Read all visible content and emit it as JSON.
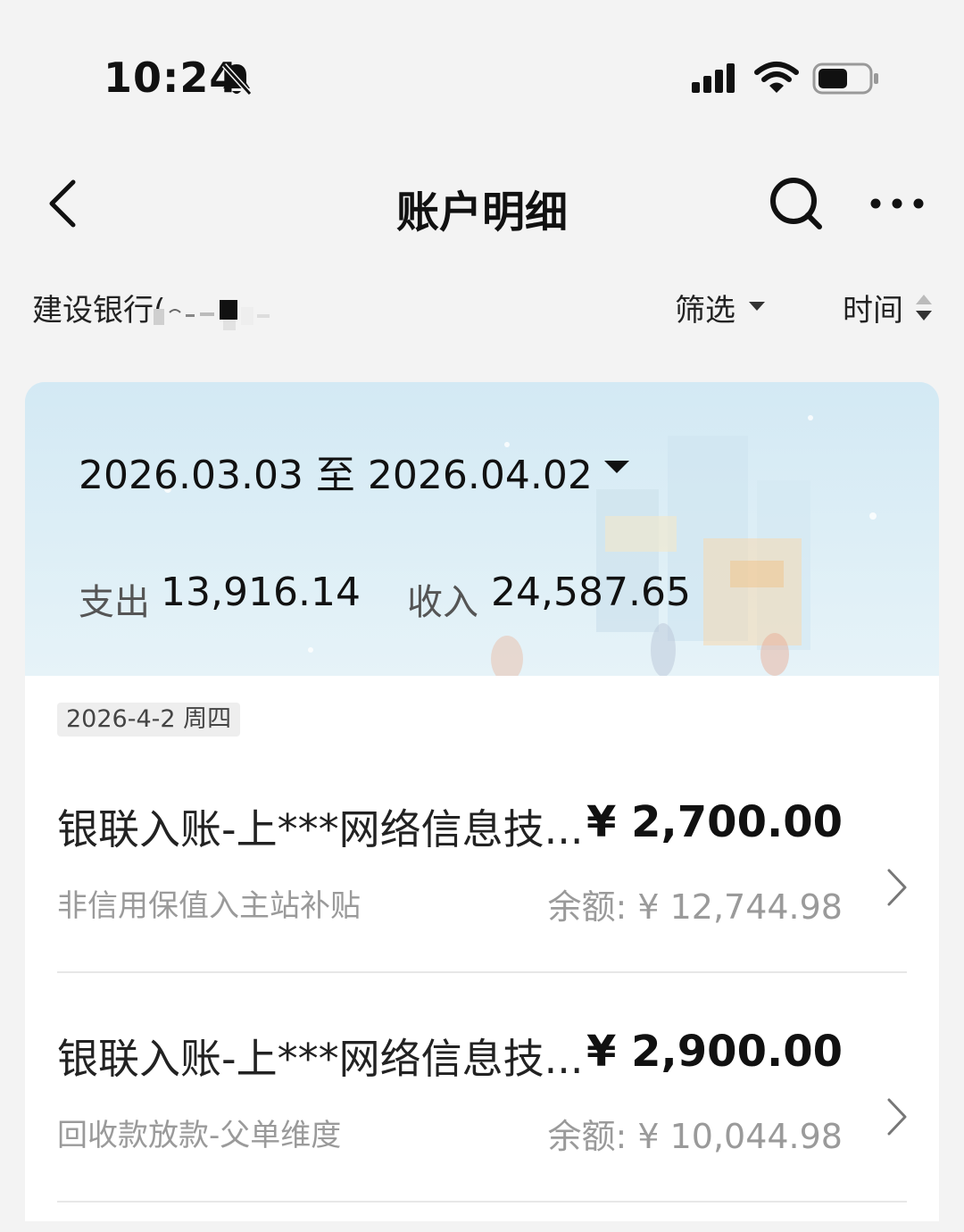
{
  "status_bar": {
    "time": "10:24"
  },
  "nav": {
    "title": "账户明细"
  },
  "filter_bar": {
    "account": "建设银行(",
    "filter_label": "筛选",
    "time_label": "时间"
  },
  "summary": {
    "date_range": "2026.03.03 至 2026.04.02",
    "expense_label": "支出",
    "expense_value": "13,916.14",
    "income_label": "收入",
    "income_value": "24,587.65"
  },
  "list": {
    "date_header": "2026-4-2 周四",
    "transactions": [
      {
        "title": "银联入账-上***网络信息技...",
        "amount": "¥ 2,700.00",
        "subtitle": "非信用保值入主站补贴",
        "balance": "余额: ¥ 12,744.98"
      },
      {
        "title": "银联入账-上***网络信息技...",
        "amount": "¥ 2,900.00",
        "subtitle": "回收款放款-父单维度",
        "balance": "余额: ¥ 10,044.98"
      }
    ]
  },
  "icons": {
    "status": [
      "bell-muted-icon",
      "signal-icon",
      "wifi-icon",
      "battery-icon"
    ],
    "nav": [
      "back-icon",
      "search-icon",
      "more-icon"
    ]
  },
  "colors": {
    "page_bg": "#f3f3f3",
    "card_bg": "#d6ebf5",
    "text_primary": "#111111",
    "text_secondary": "#9a9a9a"
  }
}
